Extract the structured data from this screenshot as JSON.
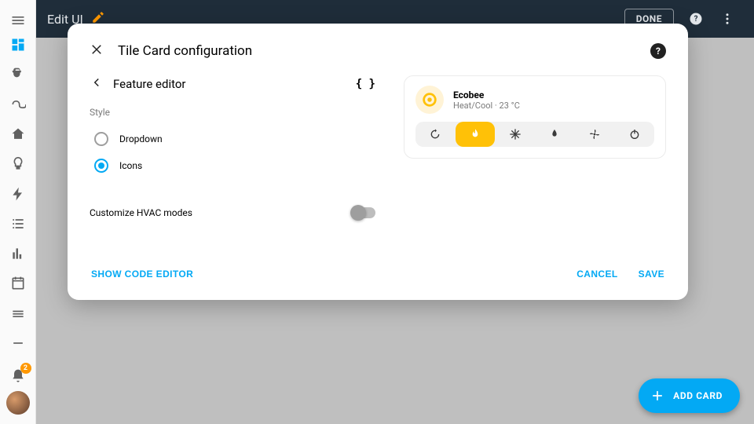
{
  "toolbar": {
    "title": "Edit UI",
    "done_label": "DONE"
  },
  "sidebar": {
    "notification_count": "2"
  },
  "fab": {
    "label": "ADD CARD"
  },
  "modal": {
    "title": "Tile Card configuration",
    "feature_editor_title": "Feature editor",
    "style_label": "Style",
    "style_options": [
      {
        "value": "dropdown",
        "label": "Dropdown",
        "selected": false
      },
      {
        "value": "icons",
        "label": "Icons",
        "selected": true
      }
    ],
    "customize_label": "Customize HVAC modes",
    "customize_on": false,
    "show_code_label": "SHOW CODE EDITOR",
    "cancel_label": "CANCEL",
    "save_label": "SAVE"
  },
  "preview": {
    "entity_name": "Ecobee",
    "entity_state": "Heat/Cool · 23 °C",
    "hvac_modes": [
      {
        "id": "auto",
        "icon": "autorenew",
        "active": false
      },
      {
        "id": "heat",
        "icon": "fire",
        "active": true
      },
      {
        "id": "cool",
        "icon": "snowflake",
        "active": false
      },
      {
        "id": "heatcool",
        "icon": "water",
        "active": false
      },
      {
        "id": "fan",
        "icon": "fan",
        "active": false
      },
      {
        "id": "off",
        "icon": "power",
        "active": false
      }
    ]
  }
}
